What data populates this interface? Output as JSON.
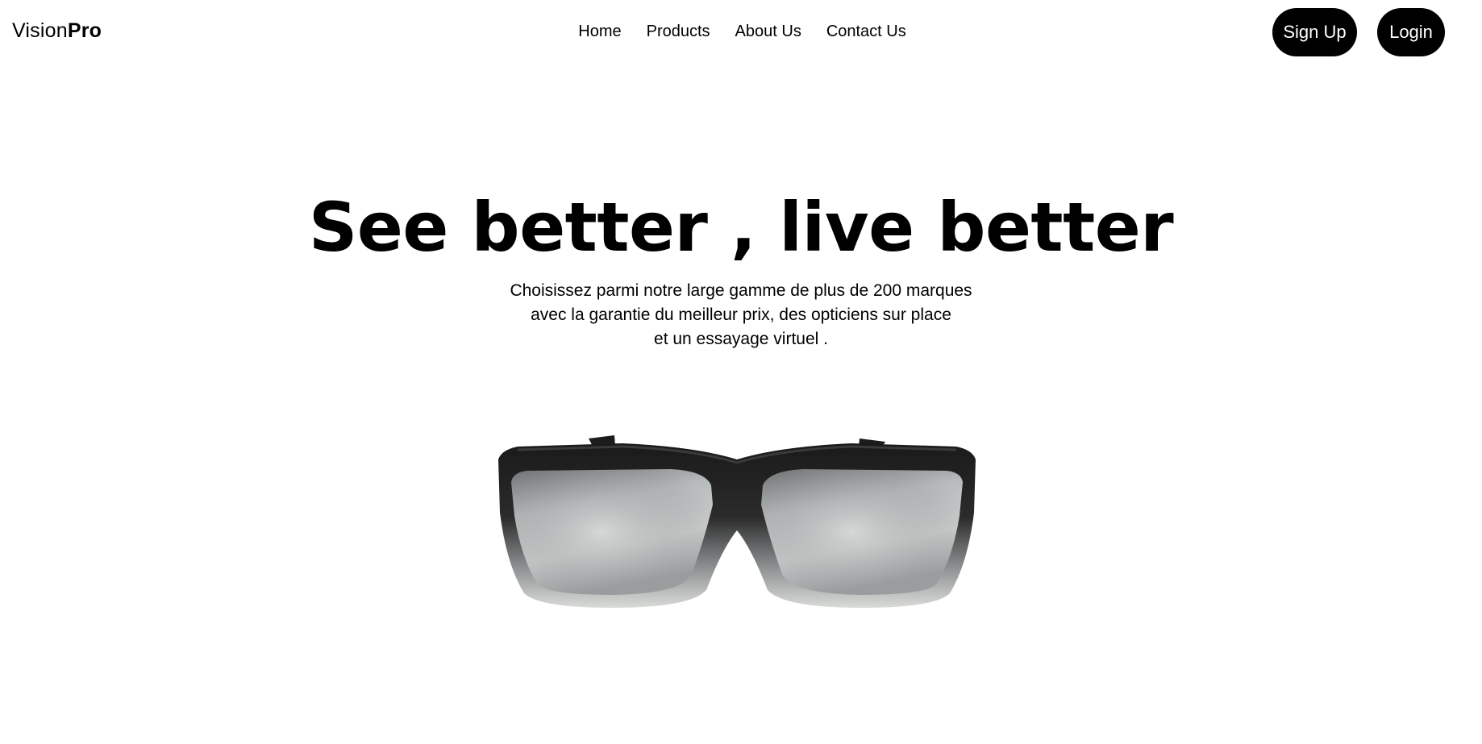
{
  "brand": {
    "name_regular": "Vision",
    "name_bold": "Pro"
  },
  "nav": {
    "items": [
      {
        "label": "Home"
      },
      {
        "label": "Products"
      },
      {
        "label": "About Us"
      },
      {
        "label": "Contact Us"
      }
    ]
  },
  "auth": {
    "signup_label": "Sign Up",
    "login_label": "Login"
  },
  "hero": {
    "title": "See better , live better",
    "subtitle_lines": [
      "Choisissez parmi notre large gamme de plus de 200 marques",
      "avec la garantie du meilleur prix, des opticiens sur place",
      "et un essayage virtuel ."
    ]
  },
  "colors": {
    "background": "#ffffff",
    "text": "#000000",
    "button_bg": "#000000",
    "button_text": "#ffffff"
  },
  "icons": {
    "product": "sunglasses-image"
  }
}
